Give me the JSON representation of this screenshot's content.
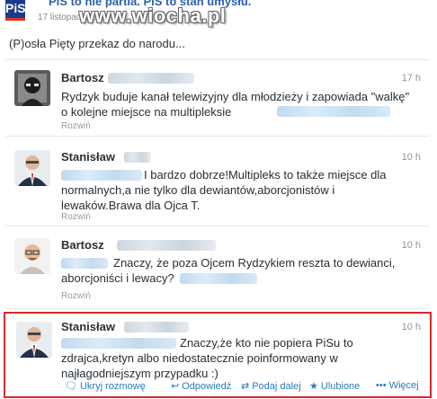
{
  "header": {
    "logo_text": "PiS",
    "title": "PiS to nie partia. PiS to stan umysłu.",
    "date": "17 listopad 2014",
    "watermark": "www.wiocha.pl",
    "caption": "(P)osła Pięty przekaz do narodu..."
  },
  "tweets": [
    {
      "name": "Bartosz",
      "time": "17 h",
      "text": "Rydzyk buduje kanał telewizyjny dla młodzieży i zapowiada \"walkę\" o kolejne miejsce na multipleksie",
      "expand": "Rozwiń"
    },
    {
      "name": "Stanisław",
      "time": "10 h",
      "text": "I bardzo dobrze!Multipleks to także miejsce dla normalnych,a nie tylko dla dewiantów,aborcjonistów i lewaków.Brawa dla Ojca T.",
      "expand": "Rozwiń"
    },
    {
      "name": "Bartosz",
      "time": "10 h",
      "text": "Znaczy, że poza Ojcem Rydzykiem reszta to dewianci, aborcjoniści i lewacy?",
      "expand": "Rozwiń"
    },
    {
      "name": "Stanisław",
      "time": "10 h",
      "text": "Znaczy,że kto nie popiera PiSu to zdrajca,kretyn albo niedostatecznie poinformowany w najłagodniejszym przypadku :)"
    }
  ],
  "actions": {
    "hide": "Ukryj rozmowę",
    "reply": "Odpowiedź",
    "retweet": "Podaj dalej",
    "favorite": "Ulubione",
    "more": "Więcej"
  },
  "colors": {
    "link": "#2b7bb9",
    "highlight_border": "#d52a2a",
    "timestamp": "#8899a6"
  }
}
